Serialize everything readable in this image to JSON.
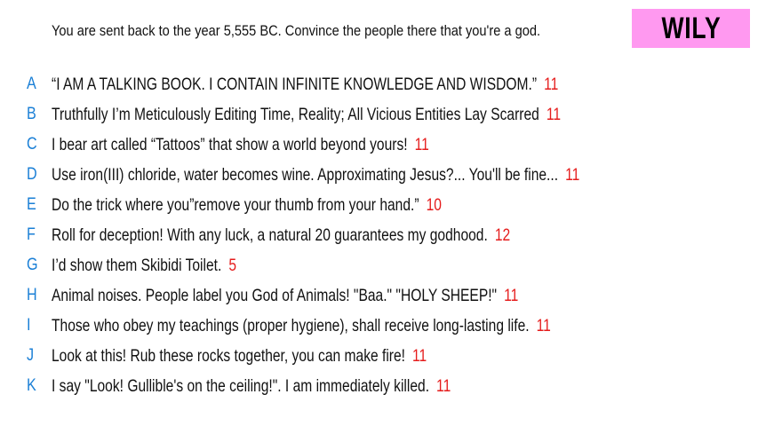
{
  "prompt": "You are sent back to the year 5,555 BC. Convince the people there that you're a god.",
  "badge": {
    "label": "WILY",
    "color": "#ff99f0"
  },
  "colors": {
    "letter": "#1a7fd6",
    "score": "#e51c1c"
  },
  "answers": [
    {
      "letter": "A",
      "text": "“I AM A TALKING BOOK. I CONTAIN INFINITE KNOWLEDGE AND WISDOM.”",
      "score": "11"
    },
    {
      "letter": "B",
      "text": "Truthfully I’m Meticulously Editing Time, Reality; All Vicious Entities Lay Scarred",
      "score": "11"
    },
    {
      "letter": "C",
      "text": "I bear art called “Tattoos” that show a world beyond yours!",
      "score": "11"
    },
    {
      "letter": "D",
      "text": "Use iron(III) chloride, water becomes wine. Approximating Jesus?... You'll be fine...",
      "score": "11"
    },
    {
      "letter": "E",
      "text": "Do the trick where you”remove your thumb from your hand.”",
      "score": "10"
    },
    {
      "letter": "F",
      "text": "Roll for deception! With any luck, a natural 20 guarantees my godhood.",
      "score": "12"
    },
    {
      "letter": "G",
      "text": "I’d show them Skibidi Toilet.",
      "score": "5"
    },
    {
      "letter": "H",
      "text": "Animal noises. People label you God of Animals! \"Baa.\" \"HOLY SHEEP!\"",
      "score": "11"
    },
    {
      "letter": "I",
      "text": "Those who obey my teachings (proper hygiene), shall receive long-lasting life.",
      "score": "11"
    },
    {
      "letter": "J",
      "text": "Look at this! Rub these rocks together, you can make fire!",
      "score": "11"
    },
    {
      "letter": "K",
      "text": "I say \"Look! Gullible's on the ceiling!\". I am immediately killed.",
      "score": "11"
    }
  ]
}
